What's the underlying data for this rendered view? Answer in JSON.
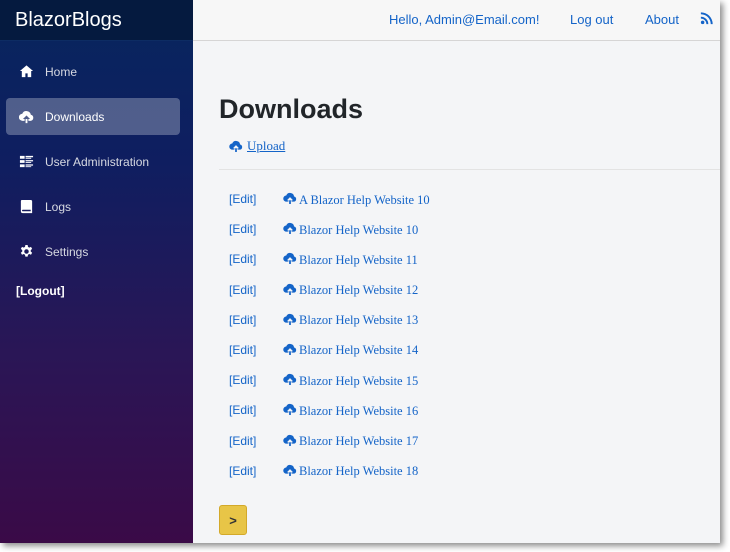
{
  "brand": "BlazorBlogs",
  "sidebar": {
    "items": [
      {
        "label": "Home",
        "icon": "home-icon",
        "active": false
      },
      {
        "label": "Downloads",
        "icon": "cloud-download-icon",
        "active": true
      },
      {
        "label": "User Administration",
        "icon": "list-icon",
        "active": false
      },
      {
        "label": "Logs",
        "icon": "book-icon",
        "active": false
      },
      {
        "label": "Settings",
        "icon": "gear-icon",
        "active": false
      }
    ],
    "logout": "[Logout]"
  },
  "topbar": {
    "greeting": "Hello, Admin@Email.com!",
    "logout": "Log out",
    "about": "About",
    "feed_icon": "rss-icon"
  },
  "main": {
    "title": "Downloads",
    "upload_label": "Upload",
    "edit_label": "[Edit]",
    "downloads": [
      "A Blazor Help Website 10",
      "Blazor Help Website 10",
      "Blazor Help Website 11",
      "Blazor Help Website 12",
      "Blazor Help Website 13",
      "Blazor Help Website 14",
      "Blazor Help Website 15",
      "Blazor Help Website 16",
      "Blazor Help Website 17",
      "Blazor Help Website 18"
    ],
    "next_label": ">"
  },
  "colors": {
    "link": "#1464c8",
    "pager": "#e8c547"
  }
}
